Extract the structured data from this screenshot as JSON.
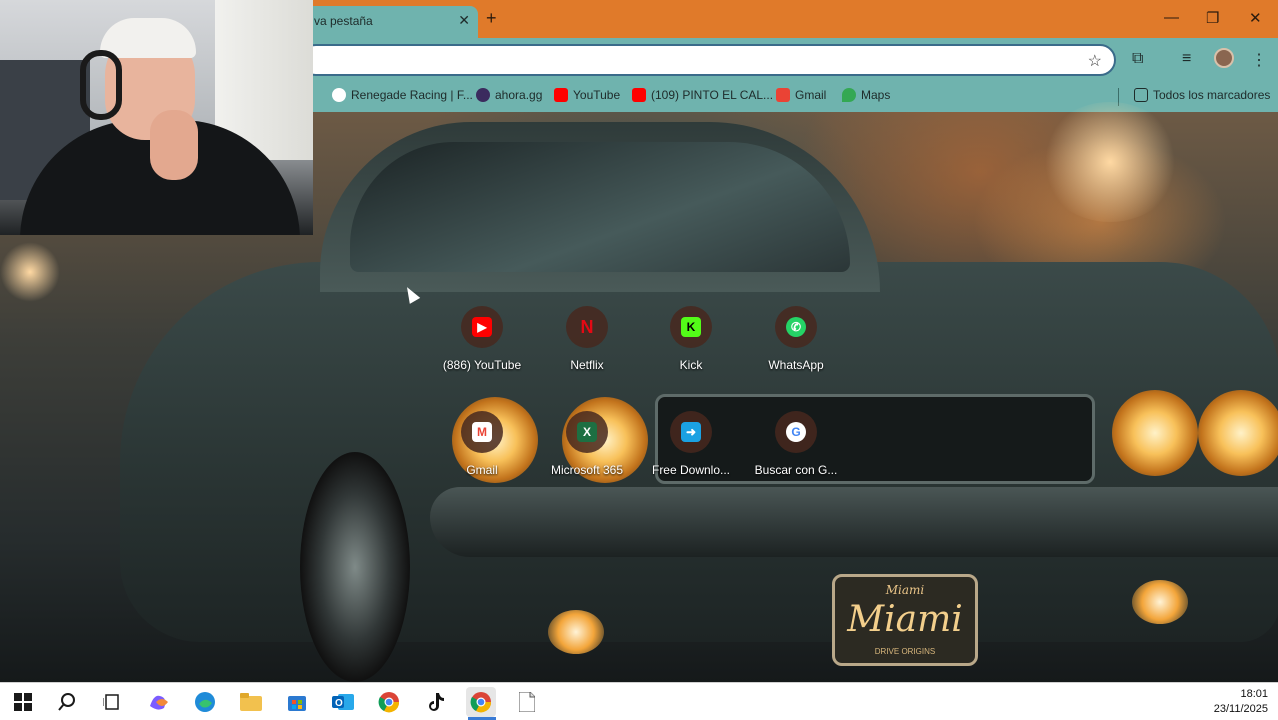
{
  "browser": {
    "tab": {
      "title": "va pestaña"
    },
    "window_controls": {
      "minimize": "—",
      "restore": "❐",
      "close": "✕"
    },
    "new_tab": "+"
  },
  "bookmarks": [
    {
      "label": "Renegade Racing | F...",
      "icon": "renegade-icon",
      "color": "#ffffff"
    },
    {
      "label": "ahora.gg",
      "icon": "ahora-icon",
      "color": "#3b2b5e"
    },
    {
      "label": "YouTube",
      "icon": "youtube-icon",
      "color": "#ff0000"
    },
    {
      "label": "(109) PINTO EL CAL...",
      "icon": "youtube-icon",
      "color": "#ff0000"
    },
    {
      "label": "Gmail",
      "icon": "gmail-icon",
      "color": "#ea4335"
    },
    {
      "label": "Maps",
      "icon": "maps-icon",
      "color": "#34a853"
    }
  ],
  "all_bookmarks_label": "Todos los marcadores",
  "shortcuts": [
    {
      "label": "(886) YouTube",
      "icon": "youtube-icon",
      "color": "#ff0000",
      "glyph": "▶"
    },
    {
      "label": "Netflix",
      "icon": "netflix-icon",
      "color": "#e50914",
      "glyph": "N"
    },
    {
      "label": "Kick",
      "icon": "kick-icon",
      "color": "#53fc18",
      "glyph": "K"
    },
    {
      "label": "WhatsApp",
      "icon": "whatsapp-icon",
      "color": "#25d366",
      "glyph": "✆"
    },
    {
      "label": "Gmail",
      "icon": "gmail-icon",
      "color": "#ea4335",
      "glyph": "M"
    },
    {
      "label": "Microsoft 365",
      "icon": "excel-icon",
      "color": "#1d6f42",
      "glyph": "X"
    },
    {
      "label": "Free Downlo...",
      "icon": "download-icon",
      "color": "#1ba1e2",
      "glyph": "➜"
    },
    {
      "label": "Buscar con G...",
      "icon": "google-icon",
      "color": "#4285f4",
      "glyph": "G"
    }
  ],
  "wallpaper": {
    "plate_top": "Miami",
    "plate_main": "Miami",
    "plate_bottom": "DRIVE ORIGINS"
  },
  "taskbar": {
    "time": "18:01",
    "date": "23/11/2025",
    "apps": [
      "windows-start-icon",
      "search-icon",
      "task-view-icon",
      "copilot-icon",
      "edge-icon",
      "file-explorer-icon",
      "store-icon",
      "outlook-icon",
      "chrome-icon",
      "tiktok-icon",
      "chrome-active-icon",
      "notepad-icon"
    ]
  }
}
